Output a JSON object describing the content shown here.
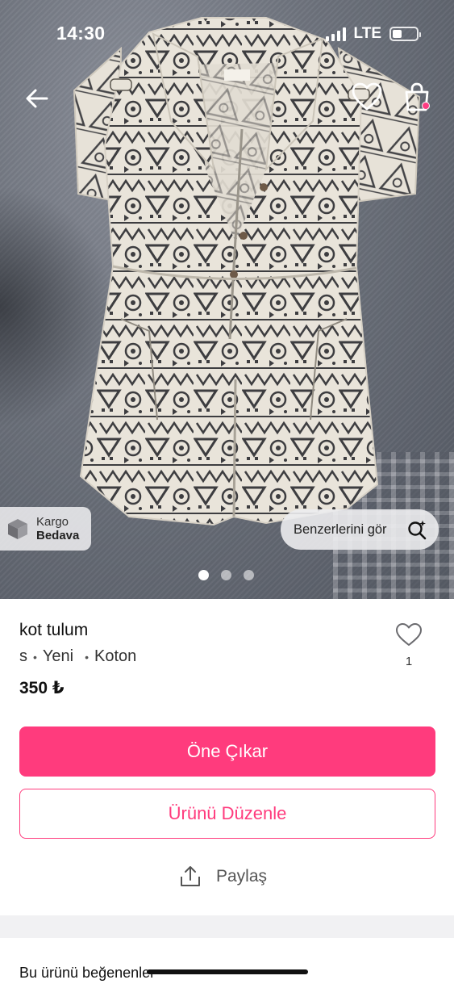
{
  "status_bar": {
    "time": "14:30",
    "network": "LTE",
    "signal_bars": 4,
    "battery_level": 0.35
  },
  "navigation": {
    "back_icon": "arrow-left-icon",
    "favorite_icon": "heart-outline-icon",
    "bag_icon": "shopping-bag-icon",
    "bag_has_notification": true
  },
  "photo": {
    "kargo_badge": {
      "icon": "box-icon",
      "line1": "Kargo",
      "line2": "Bedava"
    },
    "similar_button": {
      "label": "Benzerlerini gör",
      "icon": "search-sparkle-icon"
    },
    "pagination": {
      "count": 3,
      "active_index": 0
    }
  },
  "product": {
    "title": "kot tulum",
    "size": "s",
    "condition": "Yeni",
    "brand": "Koton",
    "price": "350 ₺",
    "like_count": "1"
  },
  "actions": {
    "primary_label": "Öne Çıkar",
    "secondary_label": "Ürünü Düzenle",
    "share_label": "Paylaş"
  },
  "section": {
    "title": "Bu ürünü beğenenler"
  },
  "colors": {
    "accent": "#ff3b7d",
    "notification_dot": "#ff3c83"
  }
}
